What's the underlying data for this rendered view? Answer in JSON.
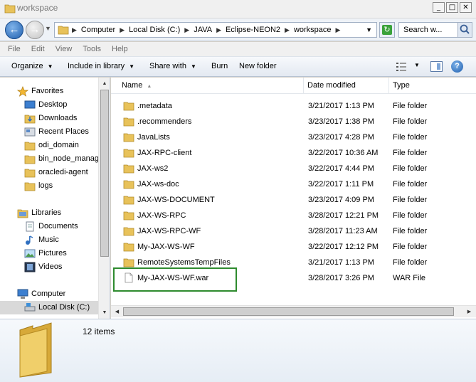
{
  "window": {
    "title": "workspace",
    "buttons": {
      "minimize": "_",
      "maximize": "□",
      "close": "✕"
    }
  },
  "address": {
    "crumbs": [
      "Computer",
      "Local Disk (C:)",
      "JAVA",
      "Eclipse-NEON2",
      "workspace"
    ],
    "search_placeholder": "Search w..."
  },
  "menu": [
    "File",
    "Edit",
    "View",
    "Tools",
    "Help"
  ],
  "toolbar": {
    "organize": "Organize",
    "include_in_library": "Include in library",
    "share_with": "Share with",
    "burn": "Burn",
    "new_folder": "New folder"
  },
  "sidebar": {
    "favorites": "Favorites",
    "favorite_items": [
      "Desktop",
      "Downloads",
      "Recent Places",
      "odi_domain",
      "bin_node_manag",
      "oracledi-agent",
      "logs"
    ],
    "libraries": "Libraries",
    "library_items": [
      "Documents",
      "Music",
      "Pictures",
      "Videos"
    ],
    "computer": "Computer",
    "computer_items": [
      "Local Disk (C:)"
    ]
  },
  "columns": {
    "name": "Name",
    "date": "Date modified",
    "type": "Type"
  },
  "files": [
    {
      "name": ".metadata",
      "date": "3/21/2017 1:13 PM",
      "type": "File folder",
      "kind": "folder"
    },
    {
      "name": ".recommenders",
      "date": "3/23/2017 1:38 PM",
      "type": "File folder",
      "kind": "folder"
    },
    {
      "name": "JavaLists",
      "date": "3/23/2017 4:28 PM",
      "type": "File folder",
      "kind": "folder"
    },
    {
      "name": "JAX-RPC-client",
      "date": "3/22/2017 10:36 AM",
      "type": "File folder",
      "kind": "folder"
    },
    {
      "name": "JAX-ws2",
      "date": "3/22/2017 4:44 PM",
      "type": "File folder",
      "kind": "folder"
    },
    {
      "name": "JAX-ws-doc",
      "date": "3/22/2017 1:11 PM",
      "type": "File folder",
      "kind": "folder"
    },
    {
      "name": "JAX-WS-DOCUMENT",
      "date": "3/23/2017 4:09 PM",
      "type": "File folder",
      "kind": "folder"
    },
    {
      "name": "JAX-WS-RPC",
      "date": "3/28/2017 12:21 PM",
      "type": "File folder",
      "kind": "folder"
    },
    {
      "name": "JAX-WS-RPC-WF",
      "date": "3/28/2017 11:23 AM",
      "type": "File folder",
      "kind": "folder"
    },
    {
      "name": "My-JAX-WS-WF",
      "date": "3/22/2017 12:12 PM",
      "type": "File folder",
      "kind": "folder"
    },
    {
      "name": "RemoteSystemsTempFiles",
      "date": "3/21/2017 1:13 PM",
      "type": "File folder",
      "kind": "folder"
    },
    {
      "name": "My-JAX-WS-WF.war",
      "date": "3/28/2017 3:26 PM",
      "type": "WAR File",
      "kind": "file"
    }
  ],
  "status": {
    "count": "12 items"
  },
  "colors": {
    "highlight": "#2e8b2e",
    "folder": "#e8c25a"
  }
}
